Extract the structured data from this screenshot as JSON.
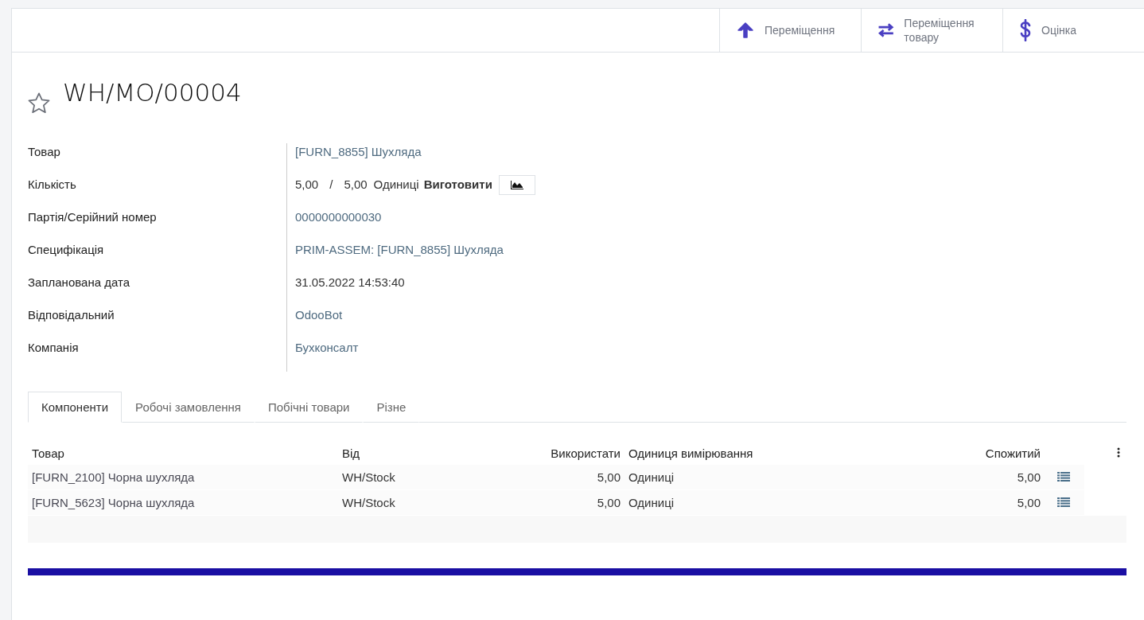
{
  "smart_buttons": [
    {
      "kind": "moves",
      "label": "Переміщення"
    },
    {
      "kind": "transfers",
      "label": "Переміщення товару"
    },
    {
      "kind": "valuation",
      "label": "Оцінка"
    }
  ],
  "record": {
    "starred": false,
    "title": "WH/MO/00004"
  },
  "fields": [
    {
      "label": "Товар",
      "kind": "link",
      "value": "[FURN_8855] Шухляда"
    },
    {
      "label": "Кількість",
      "kind": "quantity",
      "produced": "5,00",
      "separator": "/",
      "planned": "5,00",
      "unit": "Одиниці",
      "action": "Виготовити"
    },
    {
      "label": "Партія/Серійний номер",
      "kind": "link",
      "value": "0000000000030"
    },
    {
      "label": "Специфікація",
      "kind": "link",
      "value": "PRIM-ASSEM: [FURN_8855] Шухляда"
    },
    {
      "label": "Запланована дата",
      "kind": "text",
      "value": "31.05.2022 14:53:40"
    },
    {
      "label": "Відповідальний",
      "kind": "link",
      "value": "OdooBot"
    },
    {
      "label": "Компанія",
      "kind": "link",
      "value": "Бухконсалт"
    }
  ],
  "tabs": [
    {
      "label": "Компоненти",
      "selected": true
    },
    {
      "label": "Робочі замовлення",
      "selected": false
    },
    {
      "label": "Побічні товари",
      "selected": false
    },
    {
      "label": "Різне",
      "selected": false
    }
  ],
  "table": {
    "columns": [
      "Товар",
      "Від",
      "Використати",
      "Одиниця вимірювання",
      "Спожитий"
    ],
    "rows": [
      {
        "product": "[FURN_2100] Чорна шухляда",
        "from": "WH/Stock",
        "to_consume": "5,00",
        "uom": "Одиниці",
        "consumed": "5,00"
      },
      {
        "product": "[FURN_5623] Чорна шухляда",
        "from": "WH/Stock",
        "to_consume": "5,00",
        "uom": "Одиниці",
        "consumed": "5,00"
      }
    ]
  }
}
